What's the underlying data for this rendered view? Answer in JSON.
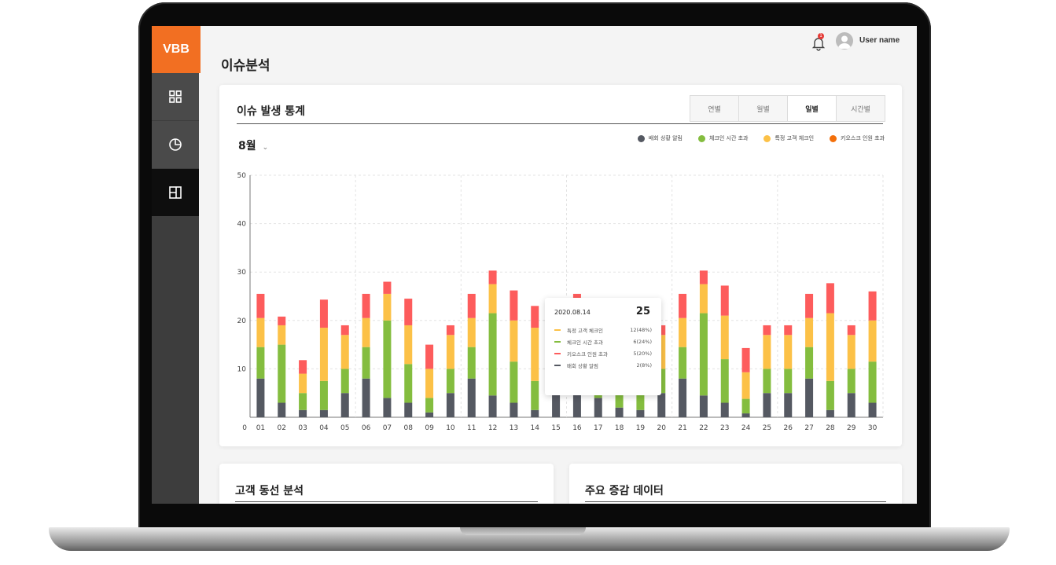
{
  "app": {
    "logo": "VBB"
  },
  "header": {
    "page_title": "이슈분석",
    "user_name": "User name",
    "notification_count": "1"
  },
  "main_card": {
    "title": "이슈 발생 통계",
    "tabs": [
      {
        "label": "연별",
        "active": false
      },
      {
        "label": "월별",
        "active": false
      },
      {
        "label": "일별",
        "active": true
      },
      {
        "label": "시간별",
        "active": false
      }
    ],
    "month_select": "8월"
  },
  "colors": {
    "accent": "#f26f22",
    "dark": "#555962",
    "green": "#84bd3f",
    "yellow": "#fcc147",
    "red": "#fd5c5c",
    "orange": "#f36f0a"
  },
  "chart_data": {
    "type": "bar",
    "stacked": true,
    "categories": [
      "01",
      "02",
      "03",
      "04",
      "05",
      "06",
      "07",
      "08",
      "09",
      "10",
      "11",
      "12",
      "13",
      "14",
      "15",
      "16",
      "17",
      "18",
      "19",
      "20",
      "21",
      "22",
      "23",
      "24",
      "25",
      "26",
      "27",
      "28",
      "29",
      "30"
    ],
    "y_ticks": [
      "0",
      "10",
      "20",
      "30",
      "40",
      "50"
    ],
    "ylim": [
      0,
      50
    ],
    "grid": true,
    "legend_position": "top-right",
    "legend": [
      {
        "name": "배회 상황 알림",
        "color": "#555962"
      },
      {
        "name": "체크인 시간 초과",
        "color": "#84bd3f"
      },
      {
        "name": "특정 고객 체크인",
        "color": "#fcc147"
      },
      {
        "name": "키오스크 인원 초과",
        "color": "#f36f0a"
      }
    ],
    "series": [
      {
        "name": "배회 상황 알림",
        "color": "#555962",
        "values": [
          8,
          3,
          1.5,
          1.5,
          5,
          8,
          4,
          3,
          1,
          5,
          8,
          4.5,
          3,
          1.5,
          5,
          8,
          4,
          2,
          1.5,
          5,
          8,
          4.5,
          3,
          0.8,
          5,
          5,
          8,
          1.5,
          5,
          3
        ]
      },
      {
        "name": "체크인 시간 초과",
        "color": "#84bd3f",
        "values": [
          6.5,
          12,
          3.5,
          6,
          5,
          6.5,
          16,
          8,
          3,
          5,
          6.5,
          17,
          8.5,
          6,
          6.5,
          6,
          9,
          6,
          9.5,
          5,
          6.5,
          17,
          9,
          3,
          5,
          5,
          6.5,
          6,
          5,
          8.5
        ]
      },
      {
        "name": "특정 고객 체크인",
        "color": "#fcc147",
        "values": [
          6,
          4,
          4,
          11,
          7,
          6,
          5.5,
          8,
          6,
          7,
          6,
          6,
          8.5,
          11,
          6,
          6,
          2.5,
          7,
          5,
          7,
          6,
          6,
          9,
          5.5,
          7,
          7,
          6,
          14,
          7,
          8.5
        ]
      },
      {
        "name": "키오스크 인원 초과",
        "color": "#fd5c5c",
        "values": [
          5,
          1.8,
          2.8,
          5.8,
          2,
          5,
          2.5,
          5.5,
          5,
          2,
          5,
          2.8,
          6.2,
          4.5,
          6,
          5.5,
          2.5,
          5,
          3,
          2,
          5,
          2.8,
          6.2,
          5,
          2,
          2,
          5,
          6.2,
          2,
          6
        ]
      }
    ]
  },
  "tooltip": {
    "date": "2020.08.14",
    "total": "25",
    "rows": [
      {
        "label": "특정 고객 체크인",
        "value": "12(48%)",
        "color": "#fcc147"
      },
      {
        "label": "체크인 시간 초과",
        "value": "6(24%)",
        "color": "#84bd3f"
      },
      {
        "label": "키오스크 인원 초과",
        "value": "5(20%)",
        "color": "#fd5c5c"
      },
      {
        "label": "배회 상황 알림",
        "value": "2(8%)",
        "color": "#555962"
      }
    ]
  },
  "bottom_cards": [
    {
      "title": "고객 동선 분석"
    },
    {
      "title": "주요 증감 데이터"
    }
  ]
}
